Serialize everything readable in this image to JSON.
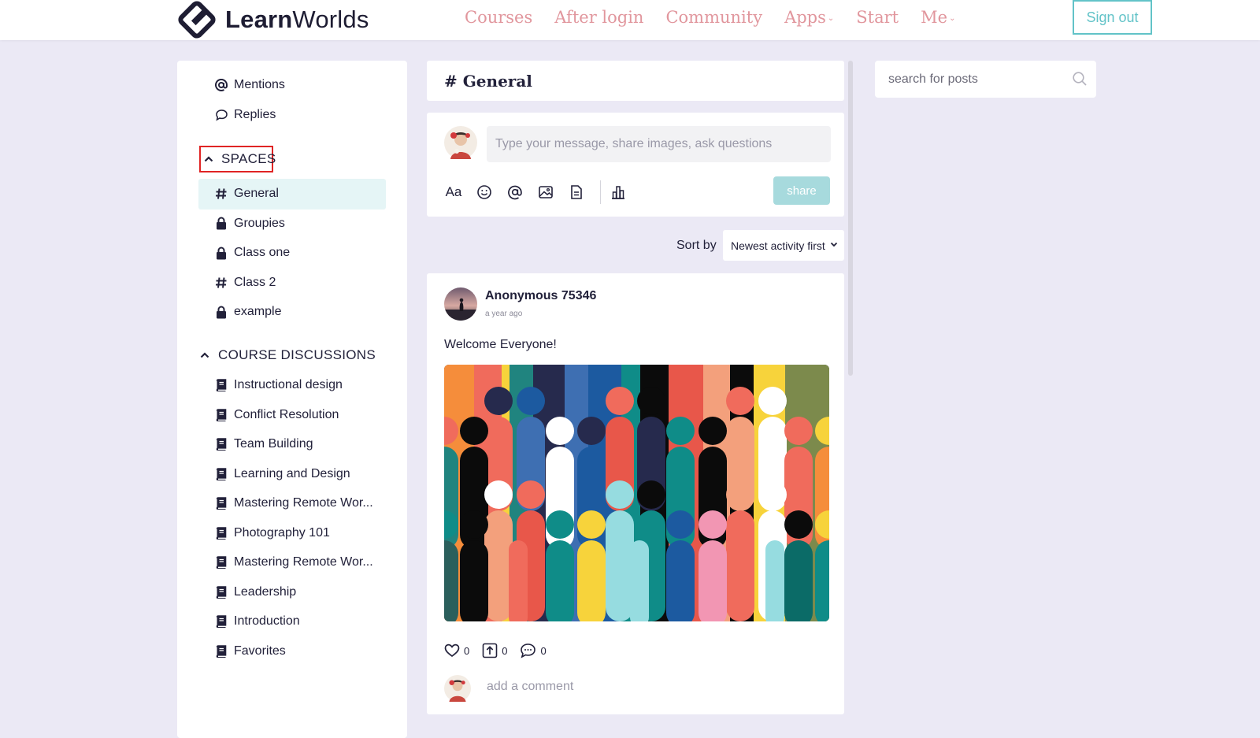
{
  "brand": {
    "name_bold": "Learn",
    "name_light": "Worlds",
    "nav_color": "#e1969d",
    "accent": "#62c3c8"
  },
  "nav": {
    "items": [
      {
        "label": "Courses",
        "icon": ""
      },
      {
        "label": "After login",
        "icon": ""
      },
      {
        "label": "Community",
        "icon": ""
      },
      {
        "label": "Apps",
        "icon": "chevron-down-icon"
      },
      {
        "label": "Start",
        "icon": ""
      },
      {
        "label": "Me",
        "icon": "chevron-down-icon"
      }
    ],
    "signout_label": "Sign out"
  },
  "sidebar": {
    "top_items": [
      {
        "label": "Mentions",
        "icon": "at-icon"
      },
      {
        "label": "Replies",
        "icon": "speech-bubble-icon"
      }
    ],
    "spaces_heading": "SPACES",
    "spaces": [
      {
        "label": "General",
        "icon": "hash-icon",
        "active": true
      },
      {
        "label": "Groupies",
        "icon": "lock-icon"
      },
      {
        "label": "Class one",
        "icon": "lock-icon"
      },
      {
        "label": "Class 2",
        "icon": "hash-icon"
      },
      {
        "label": "example",
        "icon": "lock-icon"
      }
    ],
    "courses_heading": "COURSE DISCUSSIONS",
    "courses": [
      {
        "label": "Instructional design",
        "icon": "book-icon"
      },
      {
        "label": "Conflict Resolution",
        "icon": "book-icon"
      },
      {
        "label": "Team Building",
        "icon": "book-icon"
      },
      {
        "label": "Learning and Design",
        "icon": "book-icon"
      },
      {
        "label": "Mastering Remote Wor...",
        "icon": "book-icon"
      },
      {
        "label": "Photography 101",
        "icon": "book-icon"
      },
      {
        "label": "Mastering Remote Wor...",
        "icon": "book-icon"
      },
      {
        "label": "Leadership",
        "icon": "book-icon"
      },
      {
        "label": "Introduction",
        "icon": "book-icon"
      },
      {
        "label": "Favorites",
        "icon": "book-icon"
      }
    ]
  },
  "channel": {
    "title": "# General"
  },
  "composer": {
    "placeholder": "Type your message, share images, ask questions",
    "tools": [
      "Aa",
      "emoji-icon",
      "mention-icon",
      "image-icon",
      "document-icon",
      "poll-icon"
    ],
    "share_label": "share"
  },
  "sort": {
    "label": "Sort by",
    "selected": "Newest activity first"
  },
  "post": {
    "author": "Anonymous 75346",
    "time": "a year ago",
    "text": "Welcome Everyone!",
    "likes": "0",
    "shares": "0",
    "comments": "0",
    "comment_placeholder": "add a comment"
  },
  "search": {
    "placeholder": "search for posts"
  }
}
